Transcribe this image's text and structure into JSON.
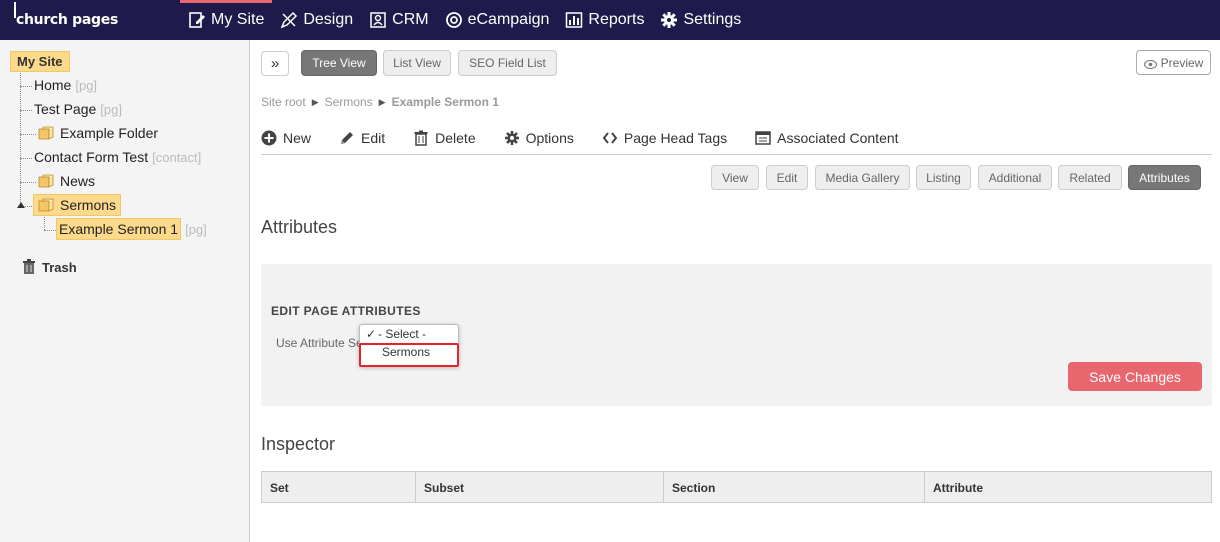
{
  "app": {
    "logo": "church pages"
  },
  "nav": [
    {
      "label": "My Site",
      "icon": "page-edit-icon",
      "active": true
    },
    {
      "label": "Design",
      "icon": "pencil-ruler-icon",
      "active": false
    },
    {
      "label": "CRM",
      "icon": "contact-card-icon",
      "active": false
    },
    {
      "label": "eCampaign",
      "icon": "at-icon",
      "active": false
    },
    {
      "label": "Reports",
      "icon": "bar-chart-icon",
      "active": false
    },
    {
      "label": "Settings",
      "icon": "gear-icon",
      "active": false
    }
  ],
  "sidebar": {
    "root": "My Site",
    "nodes": [
      {
        "label": "Home",
        "tag": "[pg]"
      },
      {
        "label": "Test Page",
        "tag": "[pg]"
      },
      {
        "label": "Example Folder",
        "tag": ""
      },
      {
        "label": "Contact Form Test",
        "tag": "[contact]"
      },
      {
        "label": "News",
        "tag": ""
      },
      {
        "label": "Sermons",
        "tag": ""
      },
      {
        "label": "Example Sermon 1",
        "tag": "[pg]"
      }
    ],
    "trash": "Trash"
  },
  "views": {
    "tree": "Tree View",
    "list": "List View",
    "seo": "SEO Field List",
    "preview": "Preview"
  },
  "breadcrumb": {
    "root": "Site root",
    "parent": "Sermons",
    "current": "Example Sermon 1"
  },
  "toolbar": {
    "new": "New",
    "edit": "Edit",
    "delete": "Delete",
    "options": "Options",
    "head_tags": "Page Head Tags",
    "associated": "Associated Content"
  },
  "tabs": [
    "View",
    "Edit",
    "Media Gallery",
    "Listing",
    "Additional",
    "Related",
    "Attributes"
  ],
  "attributes": {
    "title": "Attributes",
    "panel_title": "EDIT PAGE ATTRIBUTES",
    "label": "Use Attribute Se",
    "options": [
      "- Select -",
      "Sermons"
    ],
    "save": "Save Changes"
  },
  "inspector": {
    "title": "Inspector",
    "columns": [
      "Set",
      "Subset",
      "Section",
      "Attribute"
    ]
  },
  "colors": {
    "topbar": "#1e1a4c",
    "accent": "#e8676e",
    "highlight": "#fcd98b",
    "red_outline": "#e5232a"
  }
}
